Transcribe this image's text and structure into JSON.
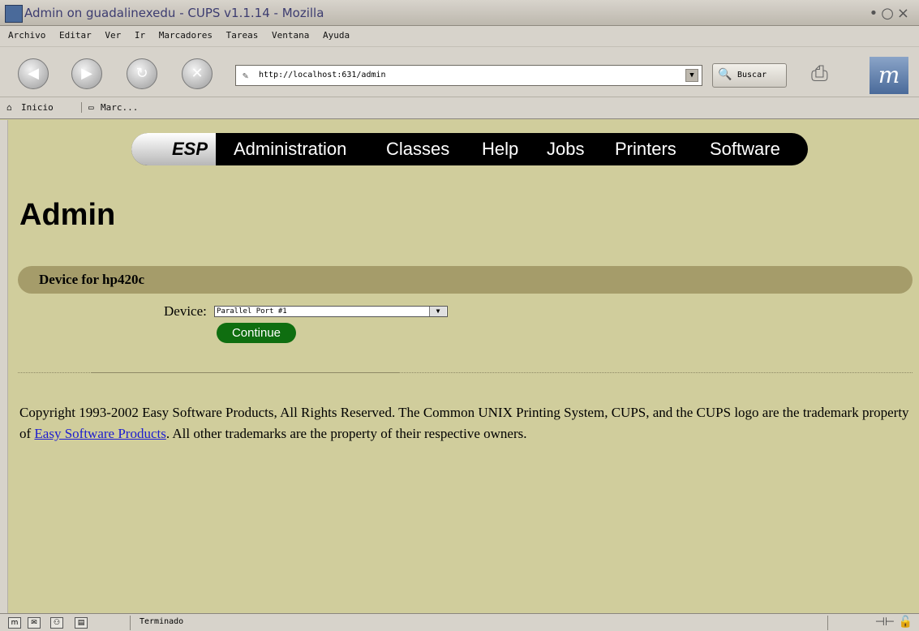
{
  "window": {
    "title": "Admin on guadalinexedu - CUPS v1.1.14 - Mozilla"
  },
  "menu": [
    "Archivo",
    "Editar",
    "Ver",
    "Ir",
    "Marcadores",
    "Tareas",
    "Ventana",
    "Ayuda"
  ],
  "toolbar": {
    "url": "http://localhost:631/admin",
    "search_label": "Buscar"
  },
  "bookmarks": {
    "home": "Inicio",
    "marks": "Marc..."
  },
  "cups_nav": {
    "brand": "ESP",
    "links": [
      "Administration",
      "Classes",
      "Help",
      "Jobs",
      "Printers",
      "Software"
    ]
  },
  "page": {
    "title": "Admin",
    "section_title": "Device for hp420c",
    "device_label": "Device:",
    "device_value": "Parallel Port #1",
    "continue_label": "Continue"
  },
  "footer": {
    "text_before": "Copyright 1993-2002 Easy Software Products, All Rights Reserved. The Common UNIX Printing System, CUPS, and the CUPS logo are the trademark property of ",
    "link": "Easy Software Products",
    "text_after": ". All other trademarks are the property of their respective owners."
  },
  "status": {
    "text": "Terminado"
  }
}
